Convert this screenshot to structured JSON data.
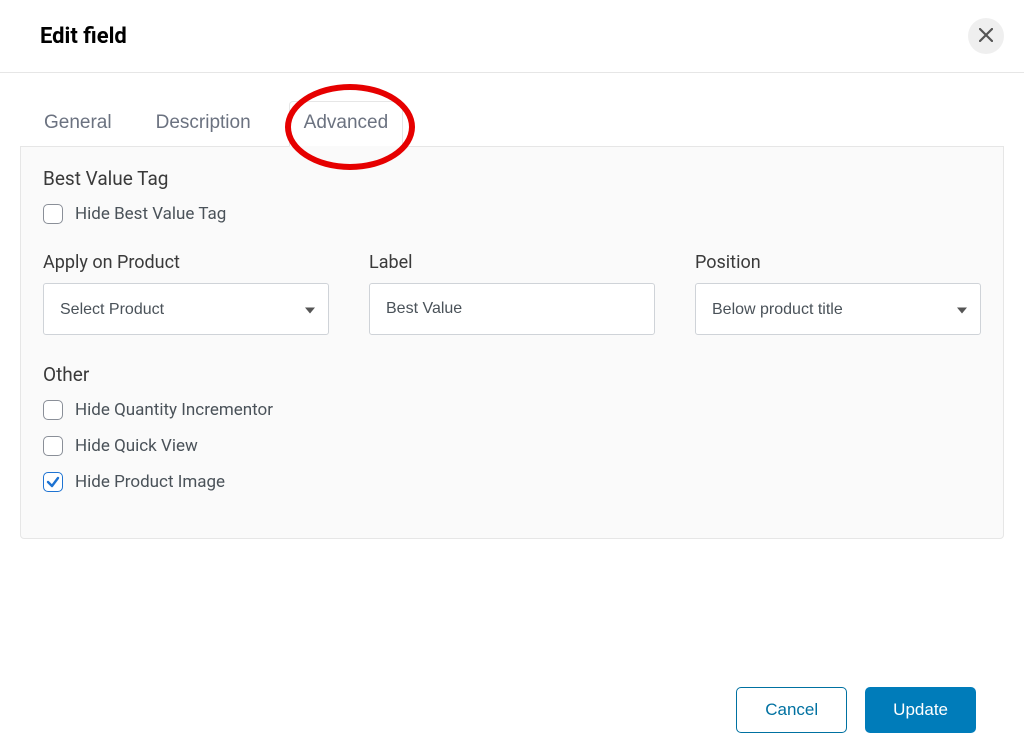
{
  "header": {
    "title": "Edit field"
  },
  "tabs": {
    "general": "General",
    "description": "Description",
    "advanced": "Advanced",
    "active": "advanced"
  },
  "sections": {
    "bestValueTag": {
      "title": "Best Value Tag",
      "hide_label": "Hide Best Value Tag",
      "hide_checked": false
    },
    "fields": {
      "applyOnProduct": {
        "label": "Apply on Product",
        "value": "Select Product"
      },
      "label": {
        "label": "Label",
        "value": "Best Value"
      },
      "position": {
        "label": "Position",
        "value": "Below product title"
      }
    },
    "other": {
      "title": "Other",
      "hideQuantity": {
        "label": "Hide Quantity Incrementor",
        "checked": false
      },
      "hideQuickView": {
        "label": "Hide Quick View",
        "checked": false
      },
      "hideProductImage": {
        "label": "Hide Product Image",
        "checked": true
      }
    }
  },
  "footer": {
    "cancel": "Cancel",
    "update": "Update"
  }
}
